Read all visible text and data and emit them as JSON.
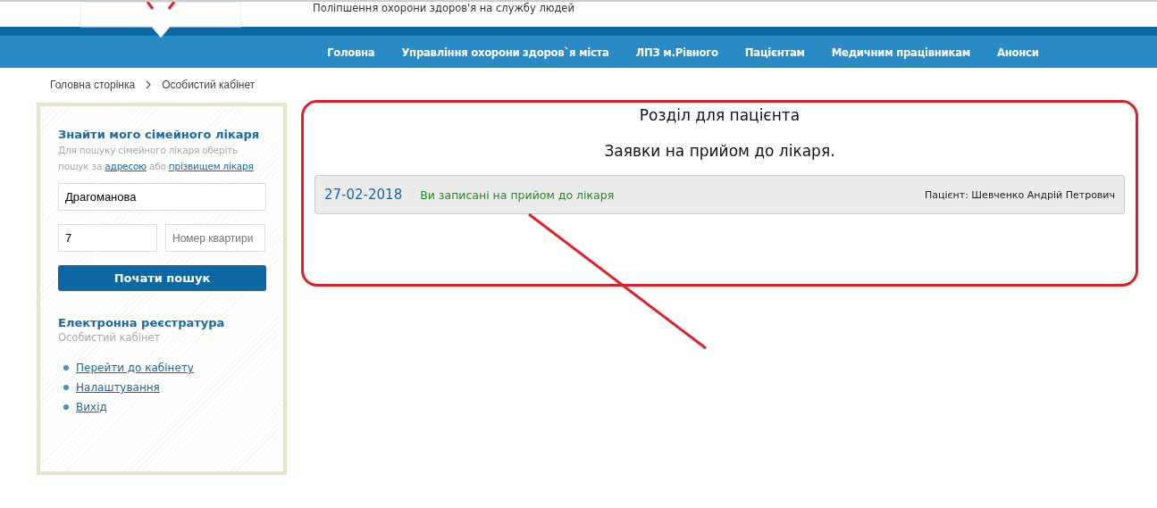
{
  "header": {
    "tagline": "Поліпшення охорони здоров'я на службу людей"
  },
  "nav": [
    {
      "label": "Головна"
    },
    {
      "label": "Управління охорони здоров`я міста"
    },
    {
      "label": "ЛПЗ м.Рівного"
    },
    {
      "label": "Пацієнтам"
    },
    {
      "label": "Медичним працівникам"
    },
    {
      "label": "Анонси"
    }
  ],
  "breadcrumb": [
    "Головна сторінка",
    "Особистий кабінет"
  ],
  "sidebar": {
    "finder": {
      "title": "Знайти мого сімейного лікаря",
      "hint": "Для пошуку сімейного лікаря оберіть пошук за",
      "link_address": "адресою",
      "hint_or": "або",
      "link_name": "прізвищем лікаря",
      "street_value": "Драгоманова",
      "house_value": "7",
      "apartment_placeholder": "Номер квартири",
      "button": "Почати пошук"
    },
    "registry": {
      "title": "Електронна реєстратура",
      "subtitle": "Особистий кабінет",
      "links": [
        "Перейти до кабінету",
        "Налаштування",
        "Вихід"
      ]
    }
  },
  "content": {
    "title": "Розділ для пацієнта",
    "subtitle": "Заявки на прийом до лікаря.",
    "appointments": [
      {
        "date": "27-02-2018",
        "status": "Ви записані на прийом до лікаря",
        "patient": "Пацієнт: Шевченко Андрій Петрович"
      }
    ]
  }
}
